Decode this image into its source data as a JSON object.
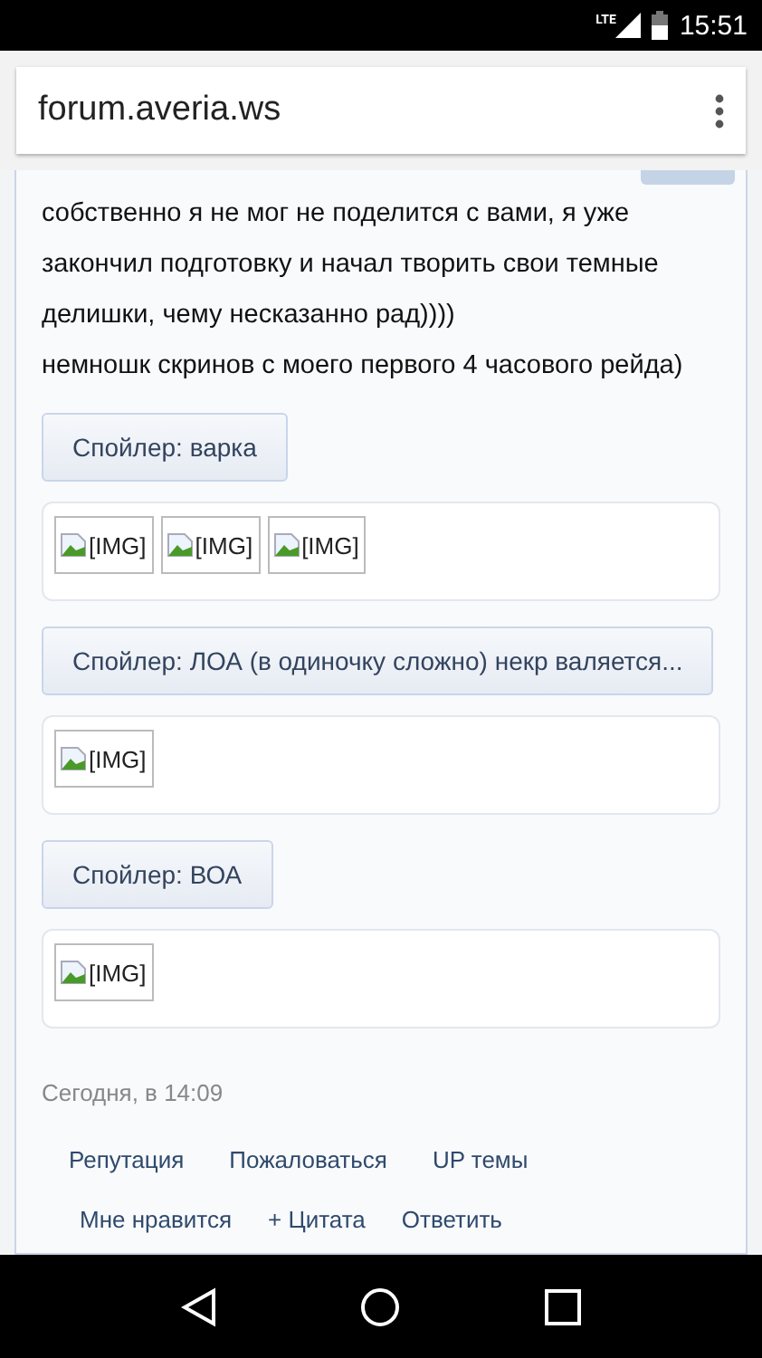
{
  "status_bar": {
    "network": "LTE",
    "time": "15:51"
  },
  "browser": {
    "url": "forum.averia.ws"
  },
  "post": {
    "lines": [
      "собственно я не мог не поделится с вами, я уже закончил подготовку и начал творить свои темные делишки, чему несказанно рад))))",
      "немношк скринов с моего первого 4 часового рейда)"
    ],
    "spoilers": [
      {
        "label": "Спойлер: варка",
        "images": [
          "[IMG]",
          "[IMG]",
          "[IMG]"
        ]
      },
      {
        "label": "Спойлер: ЛОА (в одиночку сложно) некр валяется...",
        "images": [
          "[IMG]"
        ]
      },
      {
        "label": "Спойлер: ВОА",
        "images": [
          "[IMG]"
        ]
      }
    ],
    "date": "Сегодня, в 14:09",
    "action_rows": [
      [
        "Репутация",
        "Пожаловаться",
        "UP темы"
      ],
      [
        "Мне нравится",
        "+ Цитата",
        "Ответить"
      ]
    ]
  }
}
